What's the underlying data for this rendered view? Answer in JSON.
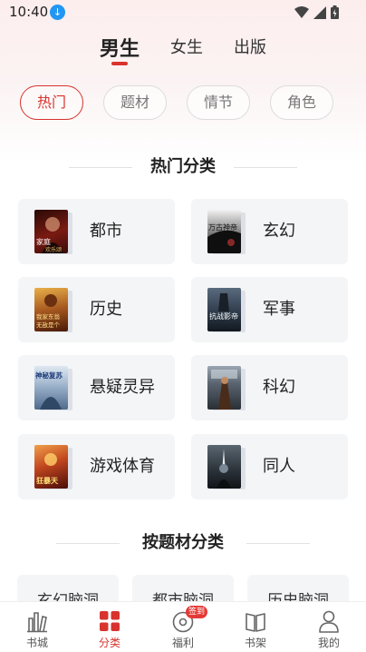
{
  "status_bar": {
    "time": "10:40",
    "notification_icon": "download-icon",
    "icons": [
      "wifi-icon",
      "signal-icon",
      "battery-icon"
    ]
  },
  "top_tabs": [
    {
      "label": "男生",
      "active": true
    },
    {
      "label": "女生",
      "active": false
    },
    {
      "label": "出版",
      "active": false
    }
  ],
  "filter_chips": [
    {
      "label": "热门",
      "active": true
    },
    {
      "label": "题材",
      "active": false
    },
    {
      "label": "情节",
      "active": false
    },
    {
      "label": "角色",
      "active": false
    }
  ],
  "hot_section": {
    "title": "热门分类",
    "categories": [
      {
        "label": "都市",
        "cover_color": "#7a1a12",
        "cover_text": "家庭 欢乐颂"
      },
      {
        "label": "玄幻",
        "cover_color": "#1b1b1b",
        "cover_text": "万古神帝"
      },
      {
        "label": "历史",
        "cover_color": "#a6581f",
        "cover_text": "我家东翁 无敌是个"
      },
      {
        "label": "军事",
        "cover_color": "#2b3848",
        "cover_text": "抗战影帝"
      },
      {
        "label": "悬疑灵异",
        "cover_color": "#6d88a8",
        "cover_text": "神秘复苏"
      },
      {
        "label": "科幻",
        "cover_color": "#3d4752",
        "cover_text": ""
      },
      {
        "label": "游戏体育",
        "cover_color": "#8a2a1e",
        "cover_text": "狂暴天"
      },
      {
        "label": "同人",
        "cover_color": "#2a3138",
        "cover_text": ""
      }
    ]
  },
  "subject_section": {
    "title": "按题材分类",
    "items": [
      {
        "label": "玄幻脑洞"
      },
      {
        "label": "都市脑洞"
      },
      {
        "label": "历史脑洞"
      }
    ]
  },
  "bottom_nav": [
    {
      "label": "书城",
      "icon": "bookstore-icon",
      "active": false
    },
    {
      "label": "分类",
      "icon": "category-grid-icon",
      "active": true
    },
    {
      "label": "福利",
      "icon": "welfare-icon",
      "active": false,
      "badge": "签到"
    },
    {
      "label": "书架",
      "icon": "bookshelf-icon",
      "active": false
    },
    {
      "label": "我的",
      "icon": "profile-icon",
      "active": false
    }
  ],
  "colors": {
    "accent": "#d8342e",
    "card_bg": "#f4f5f7"
  }
}
